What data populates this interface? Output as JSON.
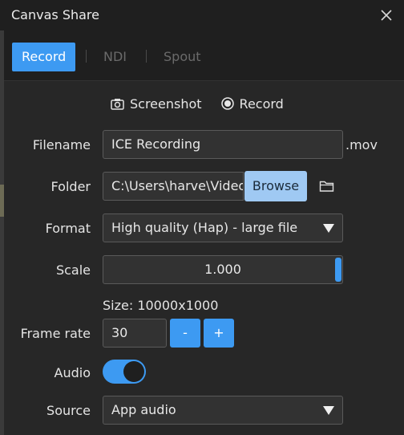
{
  "window": {
    "title": "Canvas Share"
  },
  "tabs": [
    {
      "label": "Record",
      "active": true
    },
    {
      "label": "NDI",
      "active": false
    },
    {
      "label": "Spout",
      "active": false
    }
  ],
  "mode": {
    "options": [
      {
        "label": "Screenshot",
        "icon": "camera-icon"
      },
      {
        "label": "Record",
        "icon": "radio-selected-icon"
      }
    ],
    "selected": "Record"
  },
  "form": {
    "filename": {
      "label": "Filename",
      "value": "ICE Recording",
      "suffix": ".mov"
    },
    "folder": {
      "label": "Folder",
      "value": "C:\\Users\\harve\\Videos",
      "browse_label": "Browse",
      "icon": "folder-icon"
    },
    "format": {
      "label": "Format",
      "value": "High quality (Hap) - large file"
    },
    "scale": {
      "label": "Scale",
      "value": "1.000"
    },
    "size": {
      "text": "Size: 10000x1000"
    },
    "frame_rate": {
      "label": "Frame rate",
      "value": "30",
      "decrement_label": "-",
      "increment_label": "+"
    },
    "audio": {
      "label": "Audio",
      "enabled": true
    },
    "source": {
      "label": "Source",
      "value": "App audio"
    }
  },
  "colors": {
    "accent": "#3d9af2",
    "browse_button": "#9fc9f3",
    "background": "#272727",
    "titlebar": "#1f1f1f"
  }
}
